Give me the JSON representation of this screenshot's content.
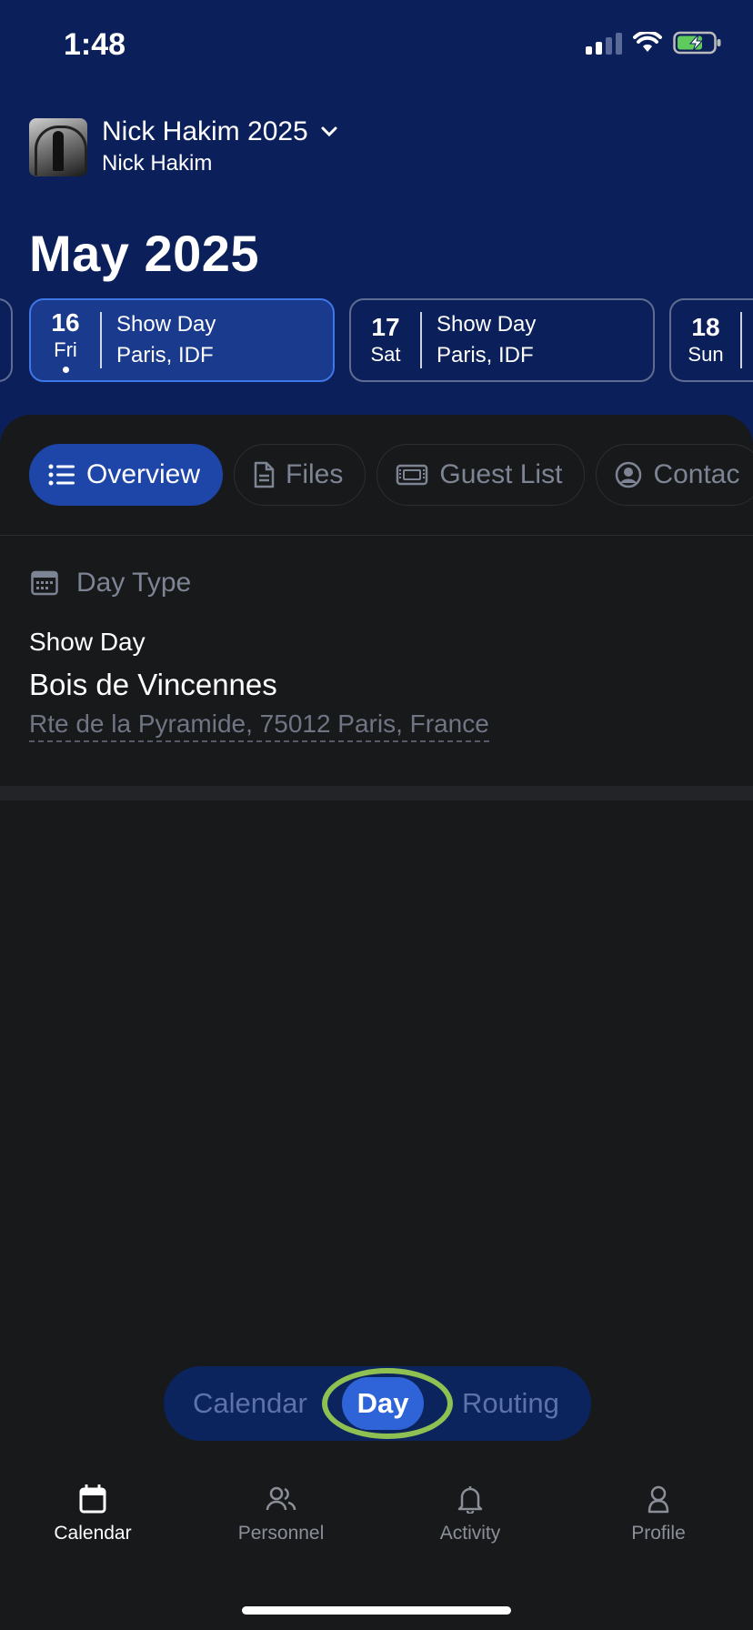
{
  "status_bar": {
    "time": "1:48"
  },
  "header": {
    "tour_title": "Nick Hakim 2025",
    "artist": "Nick Hakim",
    "month": "May 2025"
  },
  "days": [
    {
      "num": "16",
      "dow": "Fri",
      "type": "Show Day",
      "place": "Paris, IDF",
      "active": true
    },
    {
      "num": "17",
      "dow": "Sat",
      "type": "Show Day",
      "place": "Paris, IDF",
      "active": false
    },
    {
      "num": "18",
      "dow": "Sun",
      "type": "",
      "place": "",
      "active": false
    }
  ],
  "tabs": [
    {
      "label": "Overview",
      "icon": "list-icon",
      "active": true
    },
    {
      "label": "Files",
      "icon": "file-icon",
      "active": false
    },
    {
      "label": "Guest List",
      "icon": "ticket-icon",
      "active": false
    },
    {
      "label": "Contac",
      "icon": "contact-icon",
      "active": false
    }
  ],
  "overview": {
    "section_label": "Day Type",
    "day_type": "Show Day",
    "venue": "Bois de Vincennes",
    "address": "Rte de la Pyramide, 75012 Paris, France"
  },
  "view_switcher": {
    "calendar": "Calendar",
    "day": "Day",
    "routing": "Routing",
    "selected": "Day"
  },
  "tabbar": [
    {
      "label": "Calendar",
      "icon": "calendar-icon",
      "active": true
    },
    {
      "label": "Personnel",
      "icon": "people-icon",
      "active": false
    },
    {
      "label": "Activity",
      "icon": "bell-icon",
      "active": false
    },
    {
      "label": "Profile",
      "icon": "person-icon",
      "active": false
    }
  ],
  "colors": {
    "header_bg": "#0b1f5a",
    "accent": "#1e45a8",
    "highlight_ring": "#8fc152"
  }
}
